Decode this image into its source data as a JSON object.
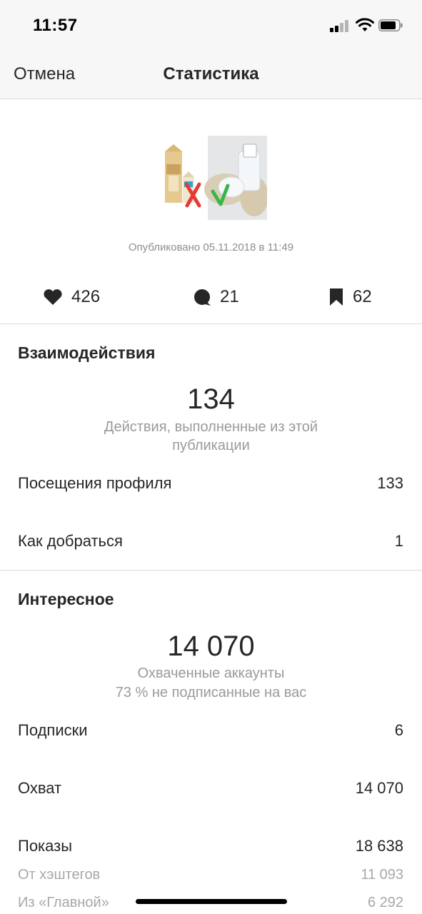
{
  "status_bar": {
    "time": "11:57"
  },
  "nav": {
    "cancel": "Отмена",
    "title": "Статистика"
  },
  "post": {
    "published": "Опубликовано 05.11.2018 в 11:49",
    "likes": "426",
    "comments": "21",
    "saves": "62"
  },
  "interactions": {
    "title": "Взаимодействия",
    "total": "134",
    "caption_line1": "Действия, выполненные из этой",
    "caption_line2": "публикации",
    "rows": [
      {
        "label": "Посещения профиля",
        "value": "133"
      },
      {
        "label": "Как добраться",
        "value": "1"
      }
    ]
  },
  "discovery": {
    "title": "Интересное",
    "total": "14 070",
    "caption_line1": "Охваченные аккаунты",
    "caption_line2": "73 % не подписанные на вас",
    "rows": [
      {
        "label": "Подписки",
        "value": "6"
      },
      {
        "label": "Охват",
        "value": "14 070"
      },
      {
        "label": "Показы",
        "value": "18 638"
      }
    ],
    "subrows": [
      {
        "label": "От хэштегов",
        "value": "11 093"
      },
      {
        "label": "Из «Главной»",
        "value": "6 292"
      }
    ]
  },
  "colors": {
    "check_green": "#3bb54a",
    "cross_red": "#e53935",
    "text_dark": "#262626",
    "text_grey": "#8e8e8e"
  }
}
